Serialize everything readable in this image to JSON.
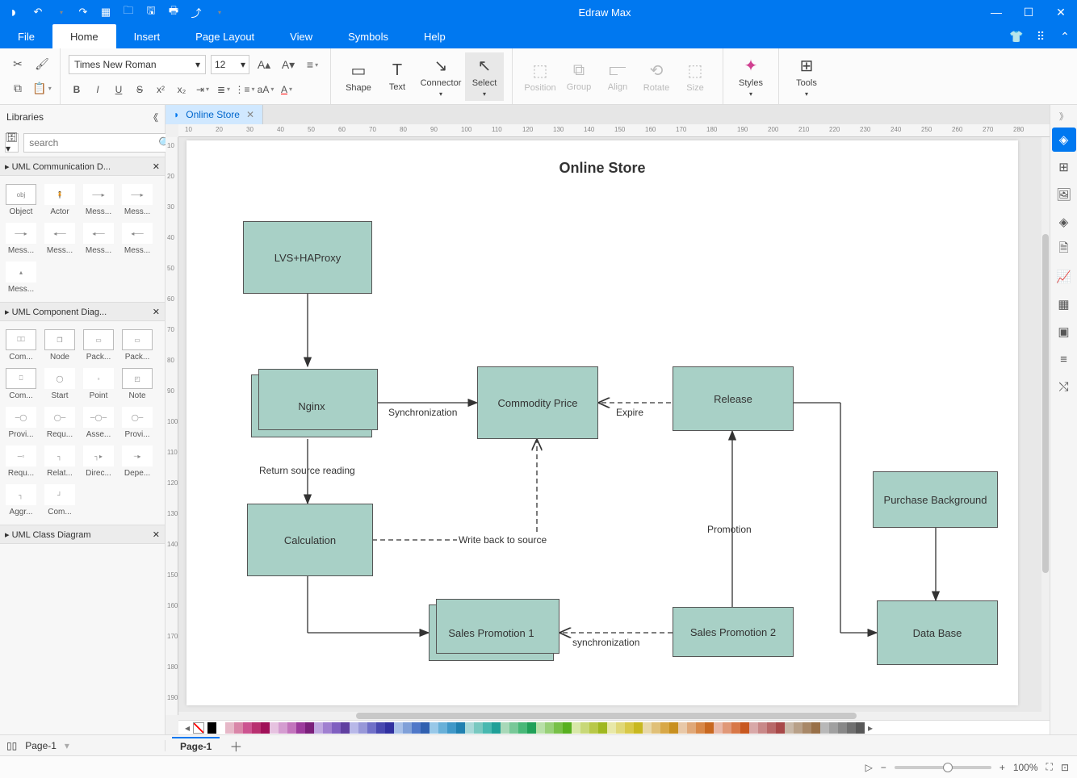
{
  "app": {
    "title": "Edraw Max"
  },
  "menu": {
    "items": [
      "File",
      "Home",
      "Insert",
      "Page Layout",
      "View",
      "Symbols",
      "Help"
    ],
    "active": 1
  },
  "ribbon": {
    "font_name": "Times New Roman",
    "font_size": "12",
    "tools": {
      "shape": "Shape",
      "text": "Text",
      "connector": "Connector",
      "select": "Select",
      "position": "Position",
      "group": "Group",
      "align": "Align",
      "rotate": "Rotate",
      "size": "Size",
      "styles": "Styles",
      "tools": "Tools"
    }
  },
  "left": {
    "title": "Libraries",
    "search_placeholder": "search",
    "sections": [
      {
        "name": "UML Communication D...",
        "items": [
          "Object",
          "Actor",
          "Mess...",
          "Mess...",
          "Mess...",
          "Mess...",
          "Mess...",
          "Mess...",
          "Mess..."
        ]
      },
      {
        "name": "UML Component Diag...",
        "items": [
          "Com...",
          "Node",
          "Pack...",
          "Pack...",
          "Com...",
          "Start",
          "Point",
          "Note",
          "Provi...",
          "Requ...",
          "Asse...",
          "Provi...",
          "Requ...",
          "Relat...",
          "Direc...",
          "Depe...",
          "Aggr...",
          "Com..."
        ]
      },
      {
        "name": "UML Class Diagram",
        "items": []
      }
    ]
  },
  "doc": {
    "tab": "Online Store",
    "title": "Online Store",
    "page_tab": "Page-1",
    "page_sel": "Page-1",
    "nodes": {
      "lvs": "LVS+HAProxy",
      "nginx": "Nginx",
      "commodity": "Commodity Price",
      "release": "Release",
      "calculation": "Calculation",
      "sp1": "Sales Promotion 1",
      "sp2": "Sales Promotion 2",
      "purchase": "Purchase Background",
      "database": "Data Base"
    },
    "labels": {
      "sync": "Synchronization",
      "expire": "Expire",
      "return": "Return source reading",
      "writeback": "Write back to source",
      "promotion": "Promotion",
      "sync2": "synchronization"
    }
  },
  "ruler_h": [
    "10",
    "20",
    "30",
    "40",
    "50",
    "60",
    "70",
    "80",
    "90",
    "100",
    "110",
    "120",
    "130",
    "140",
    "150",
    "160",
    "170",
    "180",
    "190",
    "200",
    "210",
    "220",
    "230",
    "240",
    "250",
    "260",
    "270",
    "280"
  ],
  "ruler_v": [
    "10",
    "20",
    "30",
    "40",
    "50",
    "60",
    "70",
    "80",
    "90",
    "100",
    "110",
    "120",
    "130",
    "140",
    "150",
    "160",
    "170",
    "180",
    "190"
  ],
  "status": {
    "zoom": "100%"
  },
  "colors": [
    "#000",
    "#fff",
    "#e6b8c8",
    "#d986a8",
    "#cc5490",
    "#b83070",
    "#a01058",
    "#e6c2e0",
    "#d49cd0",
    "#c274bc",
    "#9c3b9c",
    "#7a1f7a",
    "#c0a8e0",
    "#a080d0",
    "#8060c0",
    "#6040a0",
    "#b8b8e8",
    "#9898d8",
    "#7070c8",
    "#4848b0",
    "#3030a0",
    "#a8c0e8",
    "#80a0d8",
    "#5078c8",
    "#3060b0",
    "#98c8e8",
    "#68b0d8",
    "#4098c8",
    "#2080b0",
    "#a8d8d8",
    "#78c8c0",
    "#48b8b0",
    "#20a098",
    "#a8d8b8",
    "#78c898",
    "#48b878",
    "#20a058",
    "#b8e0a8",
    "#98d078",
    "#78c048",
    "#58b020",
    "#d8e8a8",
    "#c8d878",
    "#b8c848",
    "#a0b820",
    "#e8e8a8",
    "#e0d878",
    "#d8c848",
    "#c8b820",
    "#e8d8a8",
    "#e0c078",
    "#d8a848",
    "#c89020",
    "#e8c8a8",
    "#e0a878",
    "#d88848",
    "#c86820",
    "#e8b8a8",
    "#e09878",
    "#d87848",
    "#c85820",
    "#d8a8a8",
    "#c88888",
    "#b86868",
    "#a84848",
    "#c8b8a8",
    "#b8a088",
    "#a88868",
    "#987048",
    "#b8b8b8",
    "#a0a0a0",
    "#888",
    "#707070",
    "#585858"
  ]
}
